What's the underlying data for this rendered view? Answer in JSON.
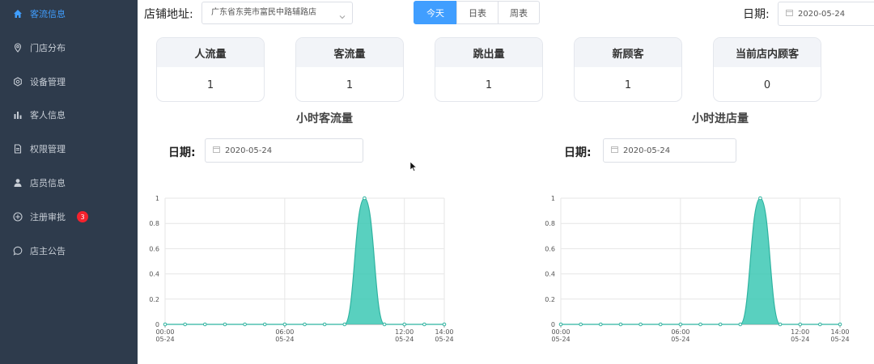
{
  "sidebar": {
    "items": [
      {
        "label": "客流信息",
        "icon": "home-icon",
        "active": true
      },
      {
        "label": "门店分布",
        "icon": "location-pin-icon"
      },
      {
        "label": "设备管理",
        "icon": "settings-icon"
      },
      {
        "label": "客人信息",
        "icon": "bar-chart-icon"
      },
      {
        "label": "权限管理",
        "icon": "document-icon"
      },
      {
        "label": "店员信息",
        "icon": "user-icon"
      },
      {
        "label": "注册审批",
        "icon": "plus-circle-icon",
        "badge": "3"
      },
      {
        "label": "店主公告",
        "icon": "chat-icon"
      }
    ]
  },
  "header": {
    "store_label": "店铺地址:",
    "store_value": "广东省东莞市富民中路辅路店",
    "tabs": [
      "今天",
      "日表",
      "周表"
    ],
    "active_tab": "今天",
    "date_label": "日期:",
    "date_value": "2020-05-24"
  },
  "stats": [
    {
      "title": "人流量",
      "value": "1"
    },
    {
      "title": "客流量",
      "value": "1"
    },
    {
      "title": "跳出量",
      "value": "1"
    },
    {
      "title": "新顾客",
      "value": "1"
    },
    {
      "title": "当前店内顾客",
      "value": "0"
    }
  ],
  "colors": {
    "sidebar_bg": "#2e3b4c",
    "accent": "#409eff",
    "series": "#3cc8b4"
  },
  "chart_data": [
    {
      "type": "area",
      "title": "小时客流量",
      "date_label": "日期:",
      "date_value": "2020-05-24",
      "x": [
        "00:00",
        "01:00",
        "02:00",
        "03:00",
        "04:00",
        "05:00",
        "06:00",
        "07:00",
        "08:00",
        "09:00",
        "10:00",
        "11:00",
        "12:00",
        "13:00",
        "14:00"
      ],
      "x_tick_labels": [
        [
          "00:00",
          "05-24"
        ],
        [
          "06:00",
          "05-24"
        ],
        [
          "12:00",
          "05-24"
        ],
        [
          "14:00",
          "05-24"
        ]
      ],
      "x_ticks_at": [
        "00:00",
        "06:00",
        "12:00",
        "14:00"
      ],
      "values": [
        0,
        0,
        0,
        0,
        0,
        0,
        0,
        0,
        0,
        0,
        1,
        0,
        0,
        0,
        0
      ],
      "ylim": [
        0,
        1
      ],
      "yticks": [
        "0",
        "0.2",
        "0.4",
        "0.6",
        "0.8",
        "1"
      ],
      "grid": true
    },
    {
      "type": "area",
      "title": "小时进店量",
      "date_label": "日期:",
      "date_value": "2020-05-24",
      "x": [
        "00:00",
        "01:00",
        "02:00",
        "03:00",
        "04:00",
        "05:00",
        "06:00",
        "07:00",
        "08:00",
        "09:00",
        "10:00",
        "11:00",
        "12:00",
        "13:00",
        "14:00"
      ],
      "x_tick_labels": [
        [
          "00:00",
          "05-24"
        ],
        [
          "06:00",
          "05-24"
        ],
        [
          "12:00",
          "05-24"
        ],
        [
          "14:00",
          "05-24"
        ]
      ],
      "x_ticks_at": [
        "00:00",
        "06:00",
        "12:00",
        "14:00"
      ],
      "values": [
        0,
        0,
        0,
        0,
        0,
        0,
        0,
        0,
        0,
        0,
        1,
        0,
        0,
        0,
        0
      ],
      "ylim": [
        0,
        1
      ],
      "yticks": [
        "0",
        "0.2",
        "0.4",
        "0.6",
        "0.8",
        "1"
      ],
      "grid": true
    }
  ]
}
